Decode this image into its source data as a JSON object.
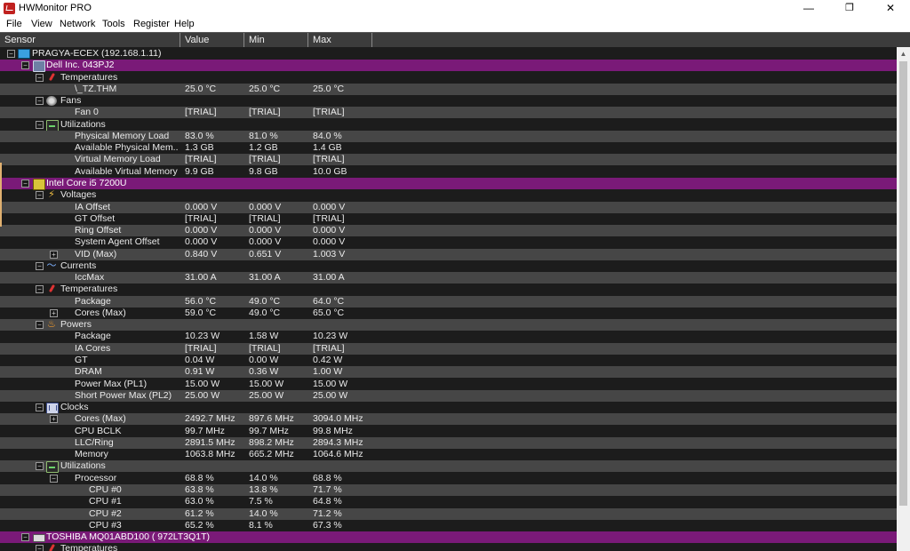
{
  "window": {
    "title": "HWMonitor PRO"
  },
  "menu": [
    "File",
    "View",
    "Network",
    "Tools",
    "Register",
    "Help"
  ],
  "columns": {
    "sensor": "Sensor",
    "value": "Value",
    "min": "Min",
    "max": "Max"
  },
  "tree": [
    {
      "level": 0,
      "exp": "-",
      "icon": "computer",
      "name": "PRAGYA-ECEX (192.168.1.11)"
    },
    {
      "level": 1,
      "exp": "-",
      "icon": "board",
      "name": "Dell Inc. 043PJ2",
      "device": true
    },
    {
      "level": 2,
      "exp": "-",
      "icon": "thermo",
      "name": "Temperatures"
    },
    {
      "level": 3,
      "name": "\\_TZ.THM",
      "value": "25.0 °C",
      "min": "25.0 °C",
      "max": "25.0 °C"
    },
    {
      "level": 2,
      "exp": "-",
      "icon": "fan",
      "name": "Fans"
    },
    {
      "level": 3,
      "name": "Fan 0",
      "value": "[TRIAL]",
      "min": "[TRIAL]",
      "max": "[TRIAL]"
    },
    {
      "level": 2,
      "exp": "-",
      "icon": "util",
      "name": "Utilizations"
    },
    {
      "level": 3,
      "name": "Physical Memory Load",
      "value": "83.0 %",
      "min": "81.0 %",
      "max": "84.0 %"
    },
    {
      "level": 3,
      "name": "Available Physical Mem...",
      "value": "1.3 GB",
      "min": "1.2 GB",
      "max": "1.4 GB"
    },
    {
      "level": 3,
      "name": "Virtual Memory Load",
      "value": "[TRIAL]",
      "min": "[TRIAL]",
      "max": "[TRIAL]"
    },
    {
      "level": 3,
      "name": "Available Virtual Memory",
      "value": "9.9 GB",
      "min": "9.8 GB",
      "max": "10.0 GB"
    },
    {
      "level": 1,
      "exp": "-",
      "icon": "cpu",
      "name": "Intel Core i5 7200U",
      "device": true
    },
    {
      "level": 2,
      "exp": "-",
      "icon": "volt",
      "name": "Voltages"
    },
    {
      "level": 3,
      "name": "IA Offset",
      "value": "0.000 V",
      "min": "0.000 V",
      "max": "0.000 V"
    },
    {
      "level": 3,
      "name": "GT Offset",
      "value": "[TRIAL]",
      "min": "[TRIAL]",
      "max": "[TRIAL]"
    },
    {
      "level": 3,
      "name": "Ring Offset",
      "value": "0.000 V",
      "min": "0.000 V",
      "max": "0.000 V"
    },
    {
      "level": 3,
      "name": "System Agent Offset",
      "value": "0.000 V",
      "min": "0.000 V",
      "max": "0.000 V"
    },
    {
      "level": 3,
      "exp": "+",
      "name": "VID (Max)",
      "value": "0.840 V",
      "min": "0.651 V",
      "max": "1.003 V"
    },
    {
      "level": 2,
      "exp": "-",
      "icon": "curr",
      "name": "Currents"
    },
    {
      "level": 3,
      "name": "IccMax",
      "value": "31.00 A",
      "min": "31.00 A",
      "max": "31.00 A"
    },
    {
      "level": 2,
      "exp": "-",
      "icon": "thermo",
      "name": "Temperatures"
    },
    {
      "level": 3,
      "name": "Package",
      "value": "56.0 °C",
      "min": "49.0 °C",
      "max": "64.0 °C"
    },
    {
      "level": 3,
      "exp": "+",
      "name": "Cores (Max)",
      "value": "59.0 °C",
      "min": "49.0 °C",
      "max": "65.0 °C"
    },
    {
      "level": 2,
      "exp": "-",
      "icon": "power",
      "name": "Powers"
    },
    {
      "level": 3,
      "name": "Package",
      "value": "10.23 W",
      "min": "1.58 W",
      "max": "10.23 W"
    },
    {
      "level": 3,
      "name": "IA Cores",
      "value": "[TRIAL]",
      "min": "[TRIAL]",
      "max": "[TRIAL]"
    },
    {
      "level": 3,
      "name": "GT",
      "value": "0.04 W",
      "min": "0.00 W",
      "max": "0.42 W"
    },
    {
      "level": 3,
      "name": "DRAM",
      "value": "0.91 W",
      "min": "0.36 W",
      "max": "1.00 W"
    },
    {
      "level": 3,
      "name": "Power Max (PL1)",
      "value": "15.00 W",
      "min": "15.00 W",
      "max": "15.00 W"
    },
    {
      "level": 3,
      "name": "Short Power Max (PL2)",
      "value": "25.00 W",
      "min": "25.00 W",
      "max": "25.00 W"
    },
    {
      "level": 2,
      "exp": "-",
      "icon": "clock",
      "name": "Clocks"
    },
    {
      "level": 3,
      "exp": "+",
      "name": "Cores (Max)",
      "value": "2492.7 MHz",
      "min": "897.6 MHz",
      "max": "3094.0 MHz"
    },
    {
      "level": 3,
      "name": "CPU BCLK",
      "value": "99.7 MHz",
      "min": "99.7 MHz",
      "max": "99.8 MHz"
    },
    {
      "level": 3,
      "name": "LLC/Ring",
      "value": "2891.5 MHz",
      "min": "898.2 MHz",
      "max": "2894.3 MHz"
    },
    {
      "level": 3,
      "name": "Memory",
      "value": "1063.8 MHz",
      "min": "665.2 MHz",
      "max": "1064.6 MHz"
    },
    {
      "level": 2,
      "exp": "-",
      "icon": "util",
      "name": "Utilizations"
    },
    {
      "level": 3,
      "exp": "-",
      "name": "Processor",
      "value": "68.8 %",
      "min": "14.0 %",
      "max": "68.8 %"
    },
    {
      "level": 4,
      "name": "CPU #0",
      "value": "63.8 %",
      "min": "13.8 %",
      "max": "71.7 %"
    },
    {
      "level": 4,
      "name": "CPU #1",
      "value": "63.0 %",
      "min": "7.5 %",
      "max": "64.8 %"
    },
    {
      "level": 4,
      "name": "CPU #2",
      "value": "61.2 %",
      "min": "14.0 %",
      "max": "71.2 %"
    },
    {
      "level": 4,
      "name": "CPU #3",
      "value": "65.2 %",
      "min": "8.1 %",
      "max": "67.3 %"
    },
    {
      "level": 1,
      "exp": "-",
      "icon": "hdd",
      "name": "TOSHIBA MQ01ABD100 (       972LT3Q1T)",
      "device": true
    },
    {
      "level": 2,
      "exp": "-",
      "icon": "thermo",
      "name": "Temperatures"
    }
  ],
  "colors": {
    "device_row": "#7a1a78",
    "stripe": "#464646",
    "background": "#1c1c1c"
  }
}
